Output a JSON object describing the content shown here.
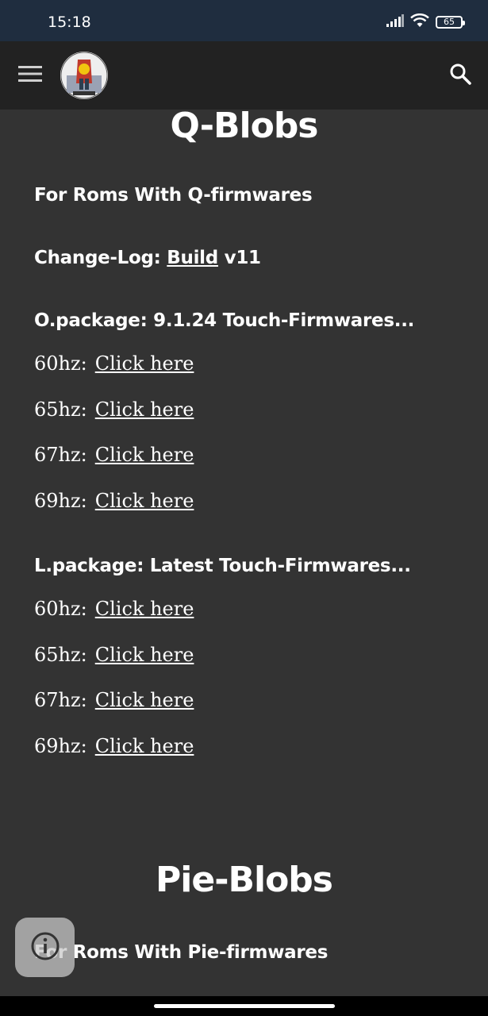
{
  "status_bar": {
    "time": "15:18",
    "battery_level": "65",
    "icons": [
      "signal-icon",
      "wifi-icon",
      "battery-icon"
    ]
  },
  "app_bar": {
    "menu_icon": "hamburger-menu-icon",
    "logo_icon": "site-logo",
    "search_icon": "search-icon"
  },
  "q_blobs": {
    "title": "Q-Blobs",
    "subtitle": "For Roms With Q-firmwares",
    "changelog_prefix": "Change-Log: ",
    "changelog_link": "Build",
    "changelog_suffix": " v11",
    "o_package": {
      "heading": "O.package: 9.1.24 Touch-Firmwares...",
      "rows": [
        {
          "label": "60hz:",
          "link": "Click here"
        },
        {
          "label": "65hz:",
          "link": "Click here"
        },
        {
          "label": "67hz:",
          "link": "Click here"
        },
        {
          "label": "69hz:",
          "link": "Click here"
        }
      ]
    },
    "l_package": {
      "heading": "L.package: Latest Touch-Firmwares...",
      "rows": [
        {
          "label": "60hz:",
          "link": "Click here"
        },
        {
          "label": "65hz:",
          "link": "Click here"
        },
        {
          "label": "67hz:",
          "link": "Click here"
        },
        {
          "label": "69hz:",
          "link": "Click here"
        }
      ]
    }
  },
  "pie_blobs": {
    "title": "Pie-Blobs",
    "subtitle": "For Roms With Pie-firmwares"
  },
  "colors": {
    "status_bar_bg": "#1f2d3f",
    "app_bar_bg": "#222222",
    "page_bg": "#333333",
    "text": "#ffffff"
  }
}
